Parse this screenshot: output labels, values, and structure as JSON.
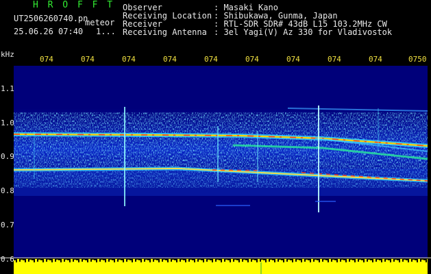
{
  "header": {
    "logo": "H R O F F T",
    "filename": "UT2506260740.pn",
    "filename_suffix": "meteor",
    "datetime": "25.06.26 07:40",
    "datetime_trail": "1..."
  },
  "station_info": [
    {
      "label": "Observer",
      "value": ": Masaki Kano"
    },
    {
      "label": "Receiving Location",
      "value": ": Shibukawa, Gunma, Japan"
    },
    {
      "label": "Receiver",
      "value": ": RTL-SDR SDR# 43dB L15 103.2MHz CW"
    },
    {
      "label": "Receiving Antenna",
      "value": ": 3el Yagi(V) Az 330 for Vladivostok"
    }
  ],
  "y_axis": {
    "unit": "kHz",
    "labels": [
      "1.1",
      "1.0",
      "0.9",
      "0.8",
      "0.7",
      "0.6"
    ]
  },
  "time_ticks": [
    "074",
    "074",
    "074",
    "074",
    "074",
    "074",
    "074",
    "074",
    "074",
    "0750"
  ],
  "colors": {
    "logo": "#33ee33",
    "ticks": "#f0e040",
    "background": "#000000",
    "plot_bg": "#00007a",
    "agc": "#ffff00"
  }
}
